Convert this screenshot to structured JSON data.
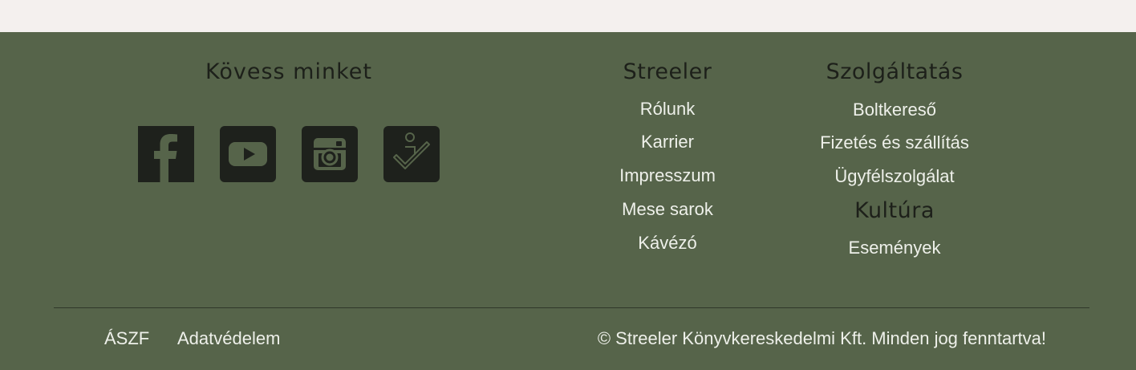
{
  "follow": {
    "title": "Kövess minket",
    "icons": [
      "facebook-icon",
      "youtube-icon",
      "instagram-icon",
      "checkin-icon"
    ]
  },
  "streeler": {
    "title": "Streeler",
    "links": [
      "Rólunk",
      "Karrier",
      "Impresszum",
      "Mese sarok",
      "Kávézó"
    ]
  },
  "services": {
    "title": "Szolgáltatás",
    "links": [
      "Boltkereső",
      "Fizetés és szállítás",
      "Ügyfélszolgálat"
    ]
  },
  "culture": {
    "title": "Kultúra",
    "links": [
      "Események"
    ]
  },
  "bottom": {
    "aszf": "ÁSZF",
    "privacy": "Adatvédelem",
    "copyright": "© Streeler Könyvkereskedelmi Kft. Minden jog fenntartva!"
  },
  "colors": {
    "footer_bg": "#56644a",
    "top_bg": "#f4f0ee",
    "icon_bg": "#1e211c",
    "heading": "#1d201a",
    "link_text": "#eef0ea"
  }
}
